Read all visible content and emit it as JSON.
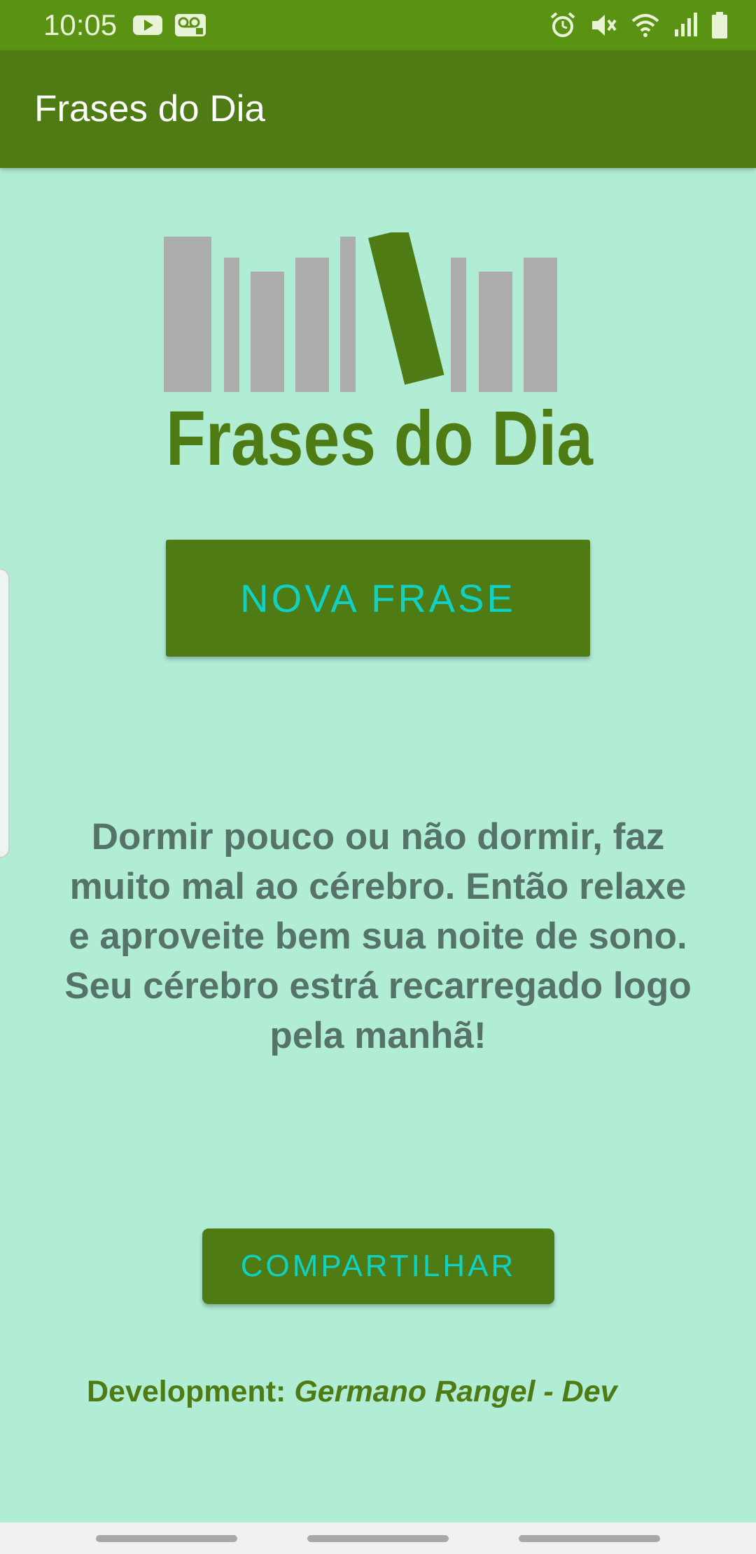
{
  "status_bar": {
    "time": "10:05",
    "left_icons": [
      "youtube-icon",
      "voicemail-icon"
    ],
    "right_icons": [
      "alarm-icon",
      "mute-icon",
      "wifi-icon",
      "signal-icon",
      "battery-icon"
    ]
  },
  "app_bar": {
    "title": "Frases do Dia"
  },
  "logo": {
    "text": "Frases do Dia"
  },
  "buttons": {
    "new_quote": "NOVA FRASE",
    "share": "COMPARTILHAR"
  },
  "quote": {
    "text": "Dormir pouco ou não dormir, faz muito mal ao cérebro. Então relaxe e aproveite bem sua noite de sono. Seu cérebro estrá recarregado logo pela manhã!"
  },
  "footer": {
    "label": "Development:",
    "author": "Germano Rangel - Dev"
  },
  "colors": {
    "status_bar": "#5a9214",
    "app_bar": "#4e7b13",
    "background": "#b1ecd5",
    "button_text": "#10d1c3",
    "quote_text": "#557368",
    "logo_books": "#adadad",
    "logo_accent": "#4e7b13"
  }
}
